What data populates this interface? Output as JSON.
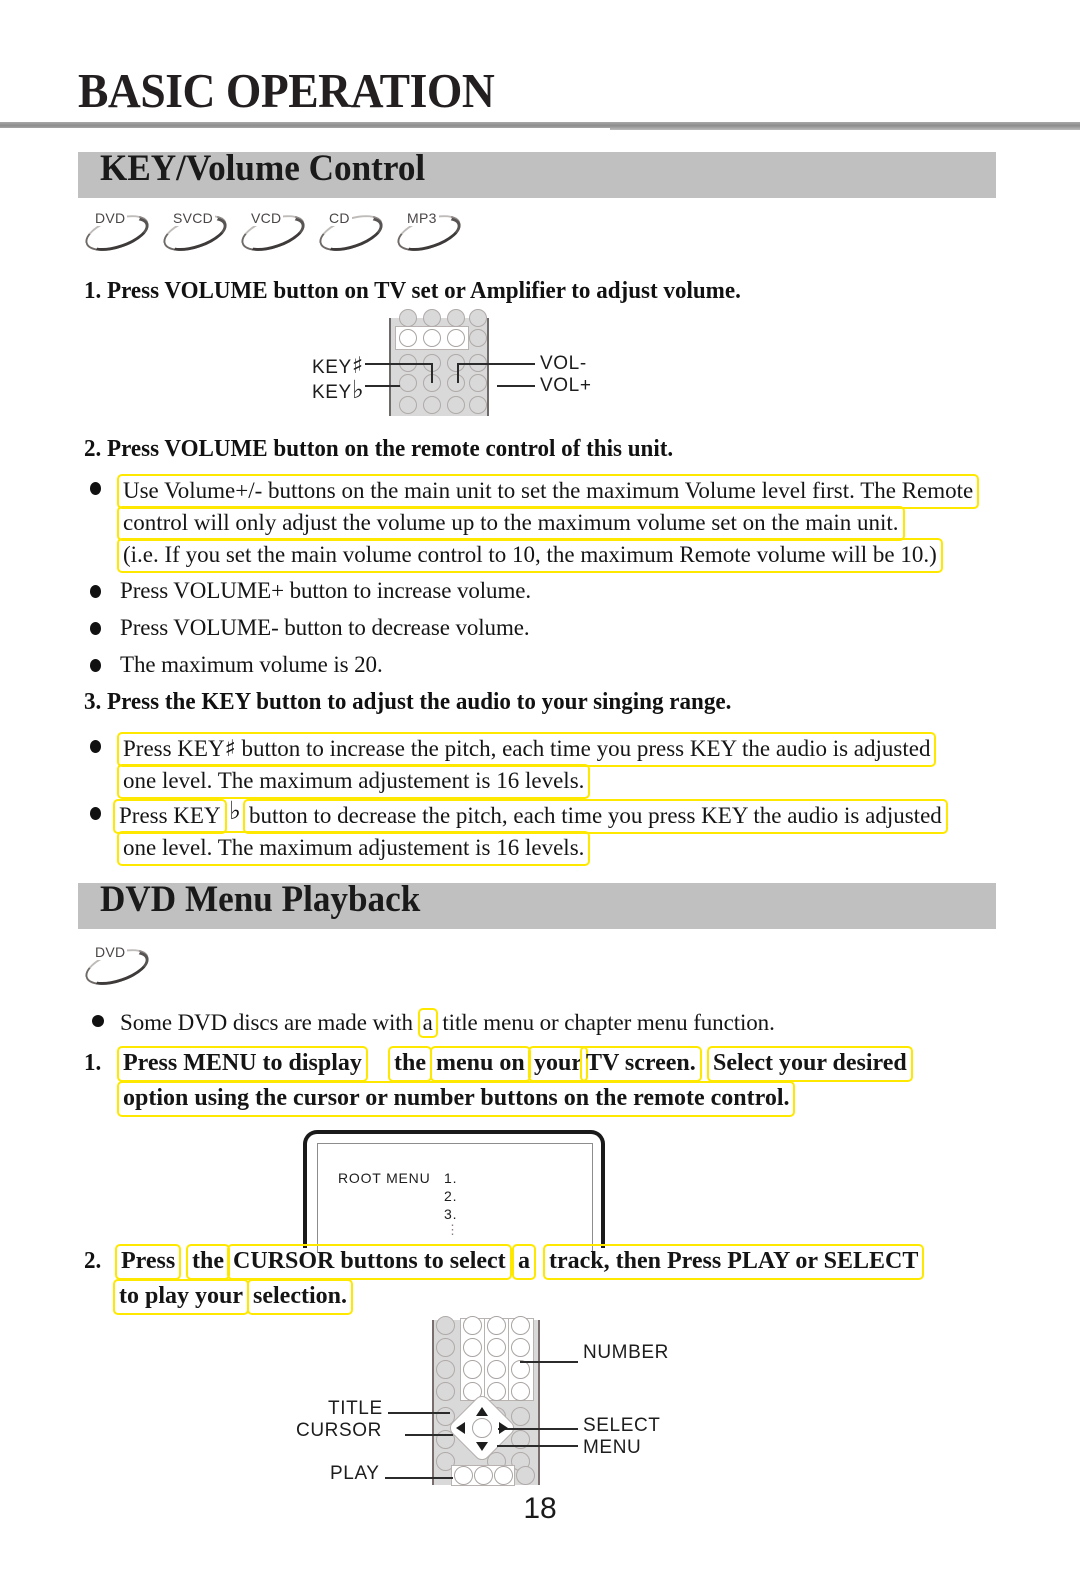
{
  "document": {
    "page_title": "BASIC OPERATION",
    "page_number": "18"
  },
  "sections": [
    {
      "id": "key-volume",
      "heading": "KEY/Volume Control",
      "disc_badges": [
        "DVD",
        "SVCD",
        "VCD",
        "CD",
        "MP3"
      ],
      "steps": [
        {
          "number": "1.",
          "heading": "1. Press VOLUME button on TV set or Amplifier to adjust volume."
        },
        {
          "number": "2.",
          "heading": "2. Press VOLUME button on the remote control of this unit."
        },
        {
          "number": "3.",
          "heading": "3. Press the KEY button to adjust the audio to your singing range."
        }
      ],
      "bullets_step2": [
        {
          "highlighted": true,
          "lines": [
            "Use Volume+/- buttons on the main unit to set the maximum Volume level first.  The Remote",
            "control will only adjust the volume up to the maximum volume set on the main unit.",
            "(i.e. If you set the main volume control to 10, the maximum Remote volume will be 10.)"
          ]
        },
        {
          "highlighted": false,
          "lines": [
            "Press VOLUME+ button to increase volume."
          ]
        },
        {
          "highlighted": false,
          "lines": [
            "Press VOLUME- button to decrease volume."
          ]
        },
        {
          "highlighted": false,
          "lines": [
            "The maximum volume is 20."
          ]
        }
      ],
      "bullets_step3": [
        {
          "prefix": "Press KEY",
          "symbol": "♯",
          "line1_rest": " button to increase the pitch, each time you press KEY the audio is adjusted",
          "line2": "one level.  The maximum adjustement is 16 levels."
        },
        {
          "prefix": "Press KEY",
          "symbol": "♭",
          "line1_rest": "button to decrease the pitch, each time you press KEY the audio is adjusted",
          "line2": "one level.  The maximum adjustement is 16 levels."
        }
      ],
      "remote_diagram": {
        "labels_left": [
          "KEY",
          "KEY"
        ],
        "symbols_left": [
          "♯",
          "♭"
        ],
        "labels_right": [
          "VOL-",
          "VOL+"
        ]
      }
    },
    {
      "id": "dvd-menu",
      "heading": "DVD Menu Playback",
      "disc_badges": [
        "DVD"
      ],
      "intro_bullet": {
        "pre": "Some DVD discs are made with",
        "highlight": "a",
        "post": "title menu or chapter menu function."
      },
      "step1": {
        "number": "1.",
        "segments": [
          "Press MENU to display",
          "the",
          "menu on",
          "your",
          "TV screen.",
          "Select your desired"
        ],
        "line2": "option using the cursor or number buttons on the remote control."
      },
      "step2": {
        "number": "2.",
        "segments": [
          "Press",
          "the",
          "CURSOR buttons to select",
          "a",
          "track, then Press PLAY or SELECT"
        ],
        "line2_segments": [
          "to play your",
          "selection."
        ]
      },
      "tv_screen": {
        "title": "ROOT MENU",
        "items": [
          "1.",
          "2.",
          "3."
        ],
        "ellipsis": "⋮"
      },
      "remote_diagram": {
        "labels_left": [
          "TITLE",
          "CURSOR",
          "PLAY"
        ],
        "labels_right": [
          "NUMBER",
          "SELECT",
          "MENU"
        ]
      }
    }
  ],
  "colors": {
    "section_bar": "#c0c0c0",
    "highlight_outline": "#ffe800",
    "text": "#151515",
    "rule": "#8d8d8d"
  }
}
